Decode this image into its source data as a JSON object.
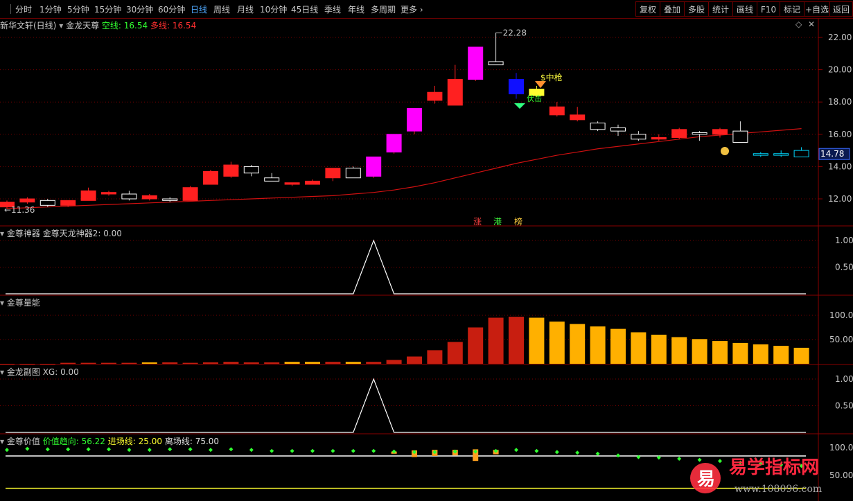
{
  "toolbar": {
    "left_tabs": [
      "分时",
      "1分钟",
      "5分钟",
      "15分钟",
      "30分钟",
      "60分钟",
      "日线",
      "周线",
      "月线",
      "10分钟",
      "45日线",
      "季线",
      "年线",
      "多周期",
      "更多"
    ],
    "active": "日线",
    "right_tabs": [
      "复权",
      "叠加",
      "多股",
      "统计",
      "画线",
      "F10",
      "标记",
      "+自选",
      "返回"
    ]
  },
  "main": {
    "title": "新华文轩(日线)",
    "indicator": "金龙天尊",
    "kong_label": "空线:",
    "kong_value": "16.54",
    "duo_label": "多线:",
    "duo_value": "16.54",
    "high_label": "22.28",
    "low_label": "11.36",
    "current_price": "14.78",
    "y_ticks": [
      "22.00",
      "20.00",
      "18.00",
      "16.00",
      "14.00",
      "12.00"
    ],
    "ann_zhongqiang": "$中枪",
    "ann_fuji": "伏击",
    "ann_zhang": "涨",
    "ann_gang": "港",
    "ann_bang": "榜"
  },
  "panels": {
    "p1_title": "金尊神器",
    "p1_label": "金尊天龙神器2:",
    "p1_value": "0.00",
    "p1_ticks": [
      "1.00",
      "0.50"
    ],
    "p2_title": "金尊量能",
    "p2_ticks": [
      "100.0",
      "50.00"
    ],
    "p3_title": "金龙副图",
    "p3_label": "XG:",
    "p3_value": "0.00",
    "p3_ticks": [
      "1.00",
      "0.50"
    ],
    "p4_title": "金尊价值",
    "p4_l1": "价值趋向:",
    "p4_v1": "56.22",
    "p4_l2": "进场线:",
    "p4_v2": "25.00",
    "p4_l3": "离场线:",
    "p4_v3": "75.00",
    "p4_ticks": [
      "100.0",
      "50.00"
    ]
  },
  "watermark": {
    "brand": "易学指标网",
    "logo_char": "易",
    "url": "www.108096.com"
  },
  "colors": {
    "up": "#ff2020",
    "down": "#00d8ff",
    "grid": "#7a0000",
    "ma": "#d01010",
    "magenta": "#ff00ff",
    "blue": "#1010ff"
  },
  "chart_data": {
    "type": "candlestick",
    "y_range": [
      11,
      23
    ],
    "candles": [
      {
        "o": 11.5,
        "h": 11.9,
        "l": 11.4,
        "c": 11.8,
        "s": "up"
      },
      {
        "o": 11.8,
        "h": 12.1,
        "l": 11.7,
        "c": 12.0,
        "s": "up"
      },
      {
        "o": 11.9,
        "h": 12.0,
        "l": 11.5,
        "c": 11.6,
        "s": "down"
      },
      {
        "o": 11.6,
        "h": 11.9,
        "l": 11.5,
        "c": 11.9,
        "s": "up"
      },
      {
        "o": 11.9,
        "h": 12.7,
        "l": 11.9,
        "c": 12.5,
        "s": "up"
      },
      {
        "o": 12.3,
        "h": 12.5,
        "l": 12.2,
        "c": 12.4,
        "s": "up"
      },
      {
        "o": 12.3,
        "h": 12.5,
        "l": 11.9,
        "c": 12.0,
        "s": "down"
      },
      {
        "o": 12.0,
        "h": 12.3,
        "l": 11.9,
        "c": 12.2,
        "s": "up"
      },
      {
        "o": 12.0,
        "h": 12.1,
        "l": 11.8,
        "c": 11.9,
        "s": "down"
      },
      {
        "o": 11.9,
        "h": 12.8,
        "l": 11.9,
        "c": 12.7,
        "s": "up"
      },
      {
        "o": 12.9,
        "h": 13.8,
        "l": 12.9,
        "c": 13.7,
        "s": "up"
      },
      {
        "o": 13.4,
        "h": 14.3,
        "l": 13.3,
        "c": 14.1,
        "s": "up"
      },
      {
        "o": 14.0,
        "h": 14.1,
        "l": 13.4,
        "c": 13.6,
        "s": "down"
      },
      {
        "o": 13.3,
        "h": 13.6,
        "l": 13.2,
        "c": 13.1,
        "s": "down"
      },
      {
        "o": 12.9,
        "h": 13.0,
        "l": 12.8,
        "c": 13.0,
        "s": "up"
      },
      {
        "o": 12.9,
        "h": 13.2,
        "l": 12.9,
        "c": 13.1,
        "s": "up"
      },
      {
        "o": 13.3,
        "h": 13.9,
        "l": 13.1,
        "c": 13.9,
        "s": "up"
      },
      {
        "o": 13.9,
        "h": 14.0,
        "l": 13.3,
        "c": 13.3,
        "s": "down"
      },
      {
        "o": 13.4,
        "h": 14.6,
        "l": 13.3,
        "c": 14.6,
        "s": "pink"
      },
      {
        "o": 14.9,
        "h": 16.0,
        "l": 14.8,
        "c": 16.0,
        "s": "pink"
      },
      {
        "o": 16.2,
        "h": 17.6,
        "l": 16.0,
        "c": 17.6,
        "s": "pink"
      },
      {
        "o": 18.1,
        "h": 19.0,
        "l": 17.9,
        "c": 18.6,
        "s": "up"
      },
      {
        "o": 17.8,
        "h": 20.3,
        "l": 17.8,
        "c": 19.4,
        "s": "up"
      },
      {
        "o": 19.4,
        "h": 21.4,
        "l": 19.3,
        "c": 21.4,
        "s": "pink"
      },
      {
        "o": 20.5,
        "h": 22.3,
        "l": 20.3,
        "c": 20.3,
        "s": "down"
      },
      {
        "o": 19.4,
        "h": 19.8,
        "l": 18.2,
        "c": 18.5,
        "s": "blue"
      },
      {
        "o": 18.4,
        "h": 19.0,
        "l": 18.3,
        "c": 18.8,
        "s": "yellow"
      },
      {
        "o": 17.7,
        "h": 18.0,
        "l": 17.1,
        "c": 17.2,
        "s": "up"
      },
      {
        "o": 17.2,
        "h": 17.7,
        "l": 16.8,
        "c": 16.9,
        "s": "up"
      },
      {
        "o": 16.7,
        "h": 16.8,
        "l": 16.2,
        "c": 16.3,
        "s": "down"
      },
      {
        "o": 16.4,
        "h": 16.6,
        "l": 15.9,
        "c": 16.2,
        "s": "down"
      },
      {
        "o": 16.0,
        "h": 16.2,
        "l": 15.6,
        "c": 15.7,
        "s": "down"
      },
      {
        "o": 15.8,
        "h": 16.0,
        "l": 15.6,
        "c": 15.7,
        "s": "up"
      },
      {
        "o": 15.8,
        "h": 16.4,
        "l": 15.7,
        "c": 16.3,
        "s": "up"
      },
      {
        "o": 16.0,
        "h": 16.2,
        "l": 15.6,
        "c": 16.1,
        "s": "down"
      },
      {
        "o": 16.0,
        "h": 16.4,
        "l": 15.8,
        "c": 16.3,
        "s": "up"
      },
      {
        "o": 16.2,
        "h": 16.8,
        "l": 15.5,
        "c": 15.5,
        "s": "down"
      },
      {
        "o": 14.7,
        "h": 14.9,
        "l": 14.6,
        "c": 14.8,
        "s": "cyan"
      },
      {
        "o": 14.7,
        "h": 15.0,
        "l": 14.6,
        "c": 14.8,
        "s": "cyan"
      },
      {
        "o": 14.6,
        "h": 15.2,
        "l": 14.6,
        "c": 15.0,
        "s": "cyan"
      }
    ],
    "ma": [
      11.4,
      11.45,
      11.5,
      11.55,
      11.6,
      11.65,
      11.7,
      11.75,
      11.8,
      11.85,
      11.9,
      11.95,
      12.0,
      12.05,
      12.1,
      12.15,
      12.2,
      12.3,
      12.4,
      12.55,
      12.75,
      13.0,
      13.3,
      13.6,
      13.9,
      14.2,
      14.45,
      14.7,
      14.9,
      15.1,
      15.25,
      15.4,
      15.55,
      15.7,
      15.85,
      15.95,
      16.05,
      16.15,
      16.25,
      16.35
    ],
    "volume_energy": [
      0,
      0,
      0,
      2,
      2,
      2,
      2,
      3,
      3,
      2,
      3,
      4,
      3,
      3,
      4,
      4,
      4,
      4,
      4,
      8,
      15,
      28,
      45,
      75,
      95,
      97,
      95,
      87,
      82,
      77,
      72,
      65,
      60,
      55,
      51,
      47,
      43,
      40,
      37,
      33
    ],
    "volume_colors": [
      "r",
      "r",
      "r",
      "r",
      "r",
      "r",
      "r",
      "o",
      "r",
      "r",
      "r",
      "r",
      "r",
      "r",
      "o",
      "o",
      "r",
      "o",
      "r",
      "r",
      "r",
      "r",
      "r",
      "r",
      "r",
      "r",
      "o",
      "o",
      "o",
      "o",
      "o",
      "o",
      "o",
      "o",
      "o",
      "o",
      "o",
      "o",
      "o",
      "o"
    ],
    "p1_peak_index": 18,
    "p3_peak_index": 18,
    "value_dots": [
      96,
      98,
      97,
      97,
      97,
      97,
      96,
      96,
      97,
      97,
      96,
      97,
      96,
      94,
      94,
      94,
      94,
      94,
      94,
      93,
      92,
      92,
      93,
      93,
      94,
      96,
      94,
      92,
      91,
      89,
      86,
      83,
      82,
      80,
      78,
      76,
      73,
      71,
      69,
      67
    ],
    "value_bars": [
      {
        "i": 19,
        "top": 93,
        "bot": 89
      },
      {
        "i": 20,
        "top": 95,
        "bot": 83
      },
      {
        "i": 21,
        "top": 96,
        "bot": 85
      },
      {
        "i": 22,
        "top": 96,
        "bot": 86
      },
      {
        "i": 23,
        "top": 97,
        "bot": 76
      },
      {
        "i": 24,
        "top": 96,
        "bot": 88
      }
    ],
    "white_line": 85,
    "yellow_line": 28
  }
}
